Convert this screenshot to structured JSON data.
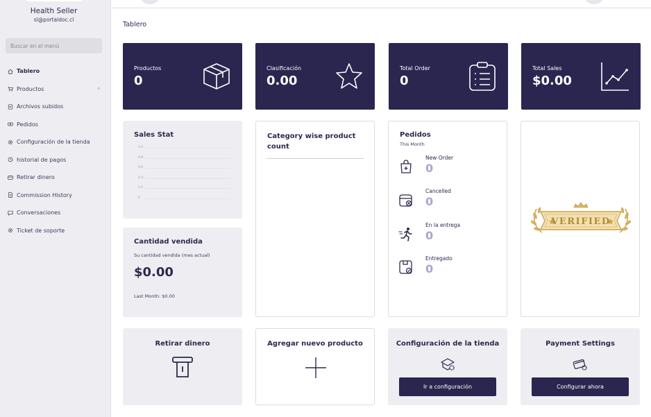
{
  "sidebar": {
    "shop_name": "Health Seller",
    "email": "sl@portaldoc.cl",
    "search_placeholder": "Buscar en el menú",
    "items": [
      {
        "label": "Tablero",
        "icon": "home-icon"
      },
      {
        "label": "Productos",
        "icon": "cart-icon"
      },
      {
        "label": "Archivos subidos",
        "icon": "folder-icon"
      },
      {
        "label": "Pedidos",
        "icon": "money-icon"
      },
      {
        "label": "Configuración de la tienda",
        "icon": "gear-icon"
      },
      {
        "label": "historial de pagos",
        "icon": "history-icon"
      },
      {
        "label": "Retirar dinero",
        "icon": "wallet-icon"
      },
      {
        "label": "Commission History",
        "icon": "document-icon"
      },
      {
        "label": "Conversaciones",
        "icon": "chat-icon"
      },
      {
        "label": "Ticket de soporte",
        "icon": "gear-icon"
      }
    ]
  },
  "page": {
    "title": "Tablero"
  },
  "stats": [
    {
      "label": "Productos",
      "value": "0",
      "icon": "box-icon"
    },
    {
      "label": "Clasificación",
      "value": "0.00",
      "icon": "star-icon"
    },
    {
      "label": "Total Order",
      "value": "0",
      "icon": "clipboard-icon"
    },
    {
      "label": "Total Sales",
      "value": "$0.00",
      "icon": "line-chart-icon"
    }
  ],
  "sales_stat": {
    "title": "Sales Stat",
    "chart_data": {
      "type": "line",
      "title": "Sales Stat",
      "yticks": [
        "1.0",
        "0.8",
        "0.6",
        "0.4",
        "0.2",
        "0"
      ],
      "ylim": [
        0,
        1.0
      ],
      "series": [],
      "grid": true
    }
  },
  "sold": {
    "title": "Cantidad vendida",
    "subtitle": "Su cantidad vendida (mes actual)",
    "value": "$0.00",
    "last_month": "Last Month: $0.00"
  },
  "category": {
    "title": "Category wise product count"
  },
  "pedidos": {
    "title": "Pedidos",
    "subtitle": "This Month",
    "rows": [
      {
        "label": "New Order",
        "value": "0",
        "icon": "bag-plus-icon"
      },
      {
        "label": "Cancelled",
        "value": "0",
        "icon": "cancel-box-icon"
      },
      {
        "label": "En la entrega",
        "value": "0",
        "icon": "runner-icon"
      },
      {
        "label": "Entregado",
        "value": "0",
        "icon": "delivered-box-icon"
      }
    ]
  },
  "verified": {
    "badge_text": "VERIFIED"
  },
  "actions": {
    "withdraw": {
      "title": "Retirar dinero"
    },
    "add_product": {
      "title": "Agregar nuevo producto"
    },
    "shop_settings": {
      "title": "Configuración de la tienda",
      "button": "Ir a configuración"
    },
    "payment": {
      "title": "Payment Settings",
      "button": "Configurar ahora"
    }
  },
  "colors": {
    "primary": "#2a2650",
    "card_grey": "#eeeef2",
    "muted_value": "#a7a7cf",
    "gold": "#c9a24a"
  }
}
